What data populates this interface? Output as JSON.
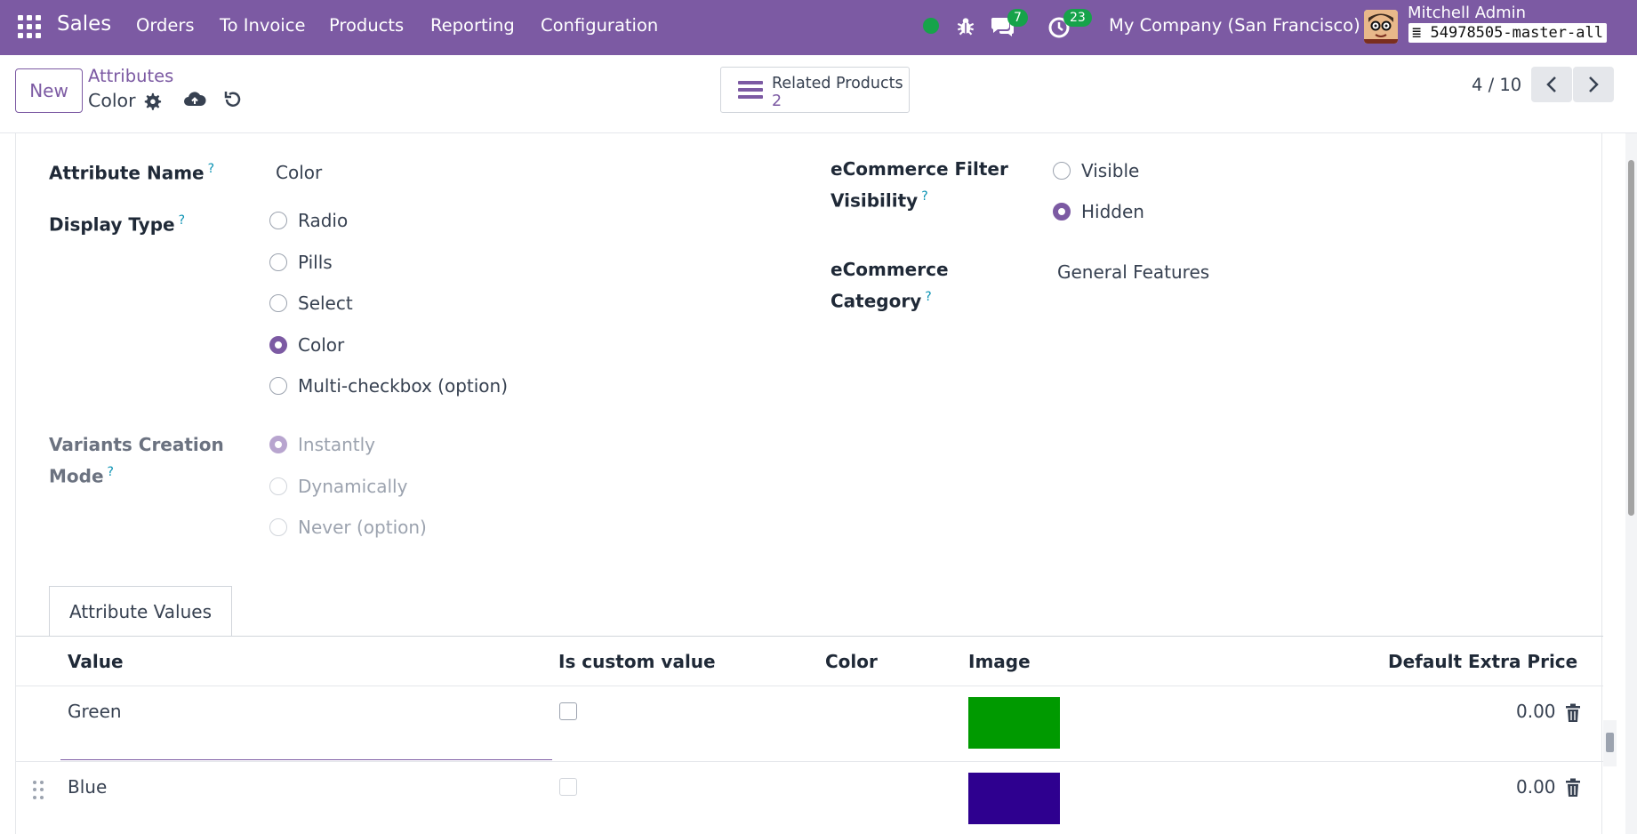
{
  "navbar": {
    "brand": "Sales",
    "menu": [
      "Orders",
      "To Invoice",
      "Products",
      "Reporting",
      "Configuration"
    ],
    "chat_count": "7",
    "activity_count": "23",
    "company": "My Company (San Francisco)",
    "user": "Mitchell Admin",
    "database": "54978505-master-all"
  },
  "control": {
    "new_label": "New",
    "breadcrumb_parent": "Attributes",
    "breadcrumb_current": "Color",
    "smart_button_label": "Related Products",
    "smart_button_count": "2",
    "pager": "4 / 10"
  },
  "form": {
    "attribute_name_label": "Attribute Name",
    "attribute_name_value": "Color",
    "display_type_label": "Display Type",
    "display_type_options": [
      {
        "label": "Radio",
        "checked": false
      },
      {
        "label": "Pills",
        "checked": false
      },
      {
        "label": "Select",
        "checked": false
      },
      {
        "label": "Color",
        "checked": true
      },
      {
        "label": "Multi-checkbox (option)",
        "checked": false
      }
    ],
    "variants_label_line1": "Variants Creation",
    "variants_label_line2": "Mode",
    "variants_options": [
      {
        "label": "Instantly",
        "checked": true
      },
      {
        "label": "Dynamically",
        "checked": false
      },
      {
        "label": "Never (option)",
        "checked": false
      }
    ],
    "filter_visibility_label_line1": "eCommerce Filter",
    "filter_visibility_label_line2": "Visibility",
    "filter_visibility_options": [
      {
        "label": "Visible",
        "checked": false
      },
      {
        "label": "Hidden",
        "checked": true
      }
    ],
    "category_label_line1": "eCommerce",
    "category_label_line2": "Category",
    "category_value": "General Features",
    "help_mark": "?"
  },
  "tabs": {
    "attribute_values": "Attribute Values"
  },
  "table": {
    "headers": [
      "Value",
      "Is custom value",
      "Color",
      "Image",
      "Default Extra Price"
    ],
    "rows": [
      {
        "value": "Green",
        "custom": false,
        "swatch": "#009a00",
        "price": "0.00"
      },
      {
        "value": "Blue",
        "custom": false,
        "swatch": "#2e008f",
        "price": "0.00"
      }
    ]
  },
  "colors": {
    "brand": "#7c5aa3",
    "online": "#16a34a",
    "help": "#0891b2"
  }
}
